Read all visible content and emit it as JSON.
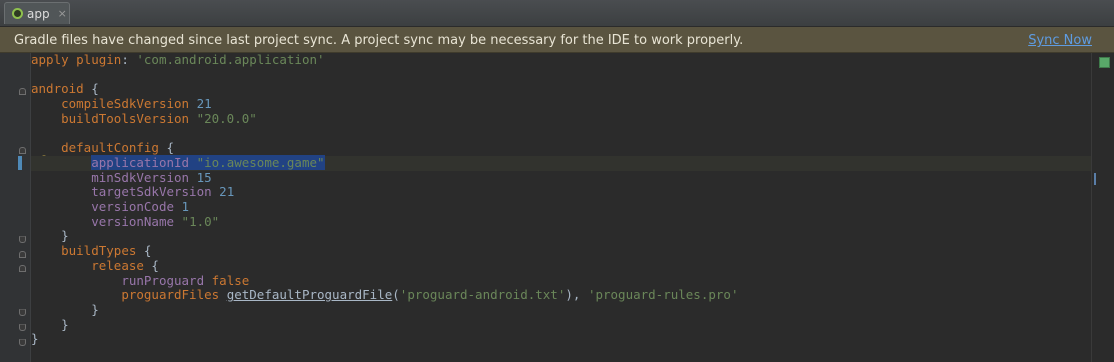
{
  "tab": {
    "label": "app",
    "close": "×"
  },
  "banner": {
    "message": "Gradle files have changed since last project sync. A project sync may be necessary for the IDE to work properly.",
    "action": "Sync Now"
  },
  "code": {
    "l1": {
      "k": "apply plugin",
      "p": ": ",
      "s": "'com.android.application'"
    },
    "l3": {
      "k": "android",
      "p": " {"
    },
    "l4": {
      "k": "compileSdkVersion",
      "n": "21"
    },
    "l5": {
      "k": "buildToolsVersion",
      "s": "\"20.0.0\""
    },
    "l7": {
      "k": "defaultConfig",
      "p": " {"
    },
    "l8": {
      "k": "applicationId",
      "s": "\"io.awesome.game\""
    },
    "l9": {
      "k": "minSdkVersion",
      "n": "15"
    },
    "l10": {
      "k": "targetSdkVersion",
      "n": "21"
    },
    "l11": {
      "k": "versionCode",
      "n": "1"
    },
    "l12": {
      "k": "versionName",
      "s": "\"1.0\""
    },
    "l13": {
      "p": "}"
    },
    "l14": {
      "k": "buildTypes",
      "p": " {"
    },
    "l15": {
      "k": "release",
      "p": " {"
    },
    "l16": {
      "k": "runProguard",
      "b": "false"
    },
    "l17": {
      "k": "proguardFiles",
      "m": "getDefaultProguardFile",
      "s1": "'proguard-android.txt'",
      "s2": "'proguard-rules.pro'"
    },
    "l18": {
      "p": "}"
    },
    "l19": {
      "p": "}"
    },
    "l20": {
      "p": "}"
    }
  },
  "colors": {
    "keyword": "#cc7832",
    "string": "#6a8759",
    "number": "#6897bb",
    "property": "#9876aa",
    "selection": "#214283",
    "banner": "#5a5440",
    "link": "#5e9ce2"
  },
  "icons": [
    "android-module-icon",
    "close-icon",
    "lightbulb-icon",
    "fold-icon",
    "analysis-ok-icon"
  ]
}
